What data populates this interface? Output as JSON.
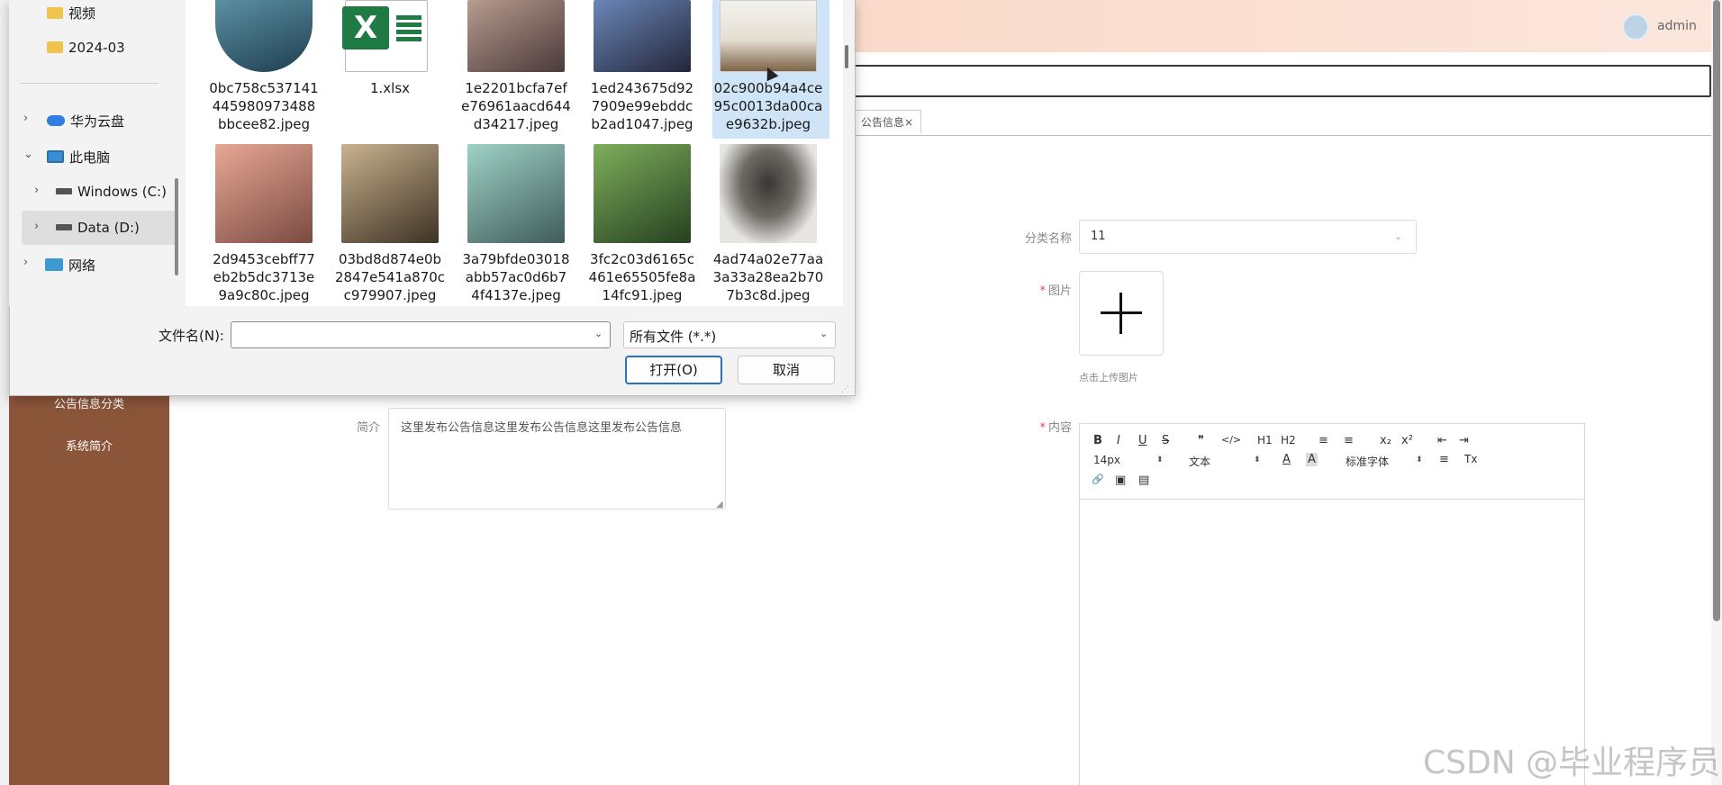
{
  "admin": {
    "user_name": "admin",
    "sidebar": {
      "items": [
        {
          "label": "公告信息分类"
        },
        {
          "label": "系统简介"
        }
      ]
    },
    "tabs": [
      {
        "label": "公告信息",
        "close": "×"
      }
    ],
    "form": {
      "category_label": "分类名称",
      "category_value": "11",
      "image_label": "图片",
      "image_hint": "点击上传图片",
      "summary_label": "简介",
      "summary_value": "这里发布公告信息这里发布公告信息这里发布公告信息",
      "content_label": "内容",
      "required_mark": "*"
    },
    "editor": {
      "font_size": "14px",
      "paragraph": "文本",
      "font_family": "标准字体",
      "buttons": [
        "B",
        "I",
        "U",
        "S",
        "❞",
        "</>",
        "H1",
        "H2",
        "≡",
        "≡",
        "x₂",
        "x²",
        "⇤",
        "⇥",
        "A",
        "A",
        "≡",
        "Tx",
        "🔗",
        "▣",
        "▤"
      ]
    }
  },
  "dialog": {
    "nav": [
      {
        "label": "视频",
        "icon": "folder-icon"
      },
      {
        "label": "2024-03",
        "icon": "folder-icon"
      },
      {
        "label": "华为云盘",
        "icon": "cloud-icon"
      },
      {
        "label": "此电脑",
        "icon": "computer-icon"
      },
      {
        "label": "Windows (C:)",
        "icon": "drive-icon"
      },
      {
        "label": "Data (D:)",
        "icon": "drive-icon"
      },
      {
        "label": "网络",
        "icon": "network-icon"
      }
    ],
    "files": [
      {
        "name": "0bc758c537141445980973488bbcee82.jpeg",
        "lines": [
          "0bc758c537141",
          "445980973488",
          "bbcee82.jpeg"
        ],
        "thumb": "#3a6f86"
      },
      {
        "name": "1.xlsx",
        "lines": [
          "1.xlsx"
        ],
        "thumb": "excel"
      },
      {
        "name": "1e2201bcfa7efe76961aacd644d34217.jpeg",
        "lines": [
          "1e2201bcfa7ef",
          "e76961aacd644",
          "d34217.jpeg"
        ],
        "thumb": "#6e5a57"
      },
      {
        "name": "1ed243675d927909e99ebddcb2ad1047.jpeg",
        "lines": [
          "1ed243675d92",
          "7909e99ebddc",
          "b2ad1047.jpeg"
        ],
        "thumb": "#3d4a6a"
      },
      {
        "name": "02c900b94a4ce95c0013da00cae9632b.jpeg",
        "lines": [
          "02c900b94a4ce",
          "95c0013da00ca",
          "e9632b.jpeg"
        ],
        "thumb": "#c4b8a6"
      },
      {
        "name": "2d9453cebff77eb2b5dc3713e9a9c80c.jpeg",
        "lines": [
          "2d9453cebff77",
          "eb2b5dc3713e",
          "9a9c80c.jpeg"
        ],
        "thumb": "#c78f7d"
      },
      {
        "name": "03bd8d874e0b2847e541a870cc979907.jpeg",
        "lines": [
          "03bd8d874e0b",
          "2847e541a870c",
          "c979907.jpeg"
        ],
        "thumb": "#8a7150"
      },
      {
        "name": "3a79bfde03018abb57ac0d6b74f4137e.jpeg",
        "lines": [
          "3a79bfde03018",
          "abb57ac0d6b7",
          "4f4137e.jpeg"
        ],
        "thumb": "#6fa79a"
      },
      {
        "name": "3fc2c03d6165c461e65505fe8a14fc91.jpeg",
        "lines": [
          "3fc2c03d6165c",
          "461e65505fe8a",
          "14fc91.jpeg"
        ],
        "thumb": "#4f7a3e"
      },
      {
        "name": "4ad74a02e77aa3a33a28ea2b707b3c8d.jpeg",
        "lines": [
          "4ad74a02e77aa",
          "3a33a28ea2b70",
          "7b3c8d.jpeg"
        ],
        "thumb": "#d9d9d6"
      }
    ],
    "filename_label": "文件名(N):",
    "filename_value": "",
    "filetype_value": "所有文件 (*.*)",
    "open_label": "打开(O)",
    "cancel_label": "取消"
  },
  "watermark": "CSDN @毕业程序员"
}
